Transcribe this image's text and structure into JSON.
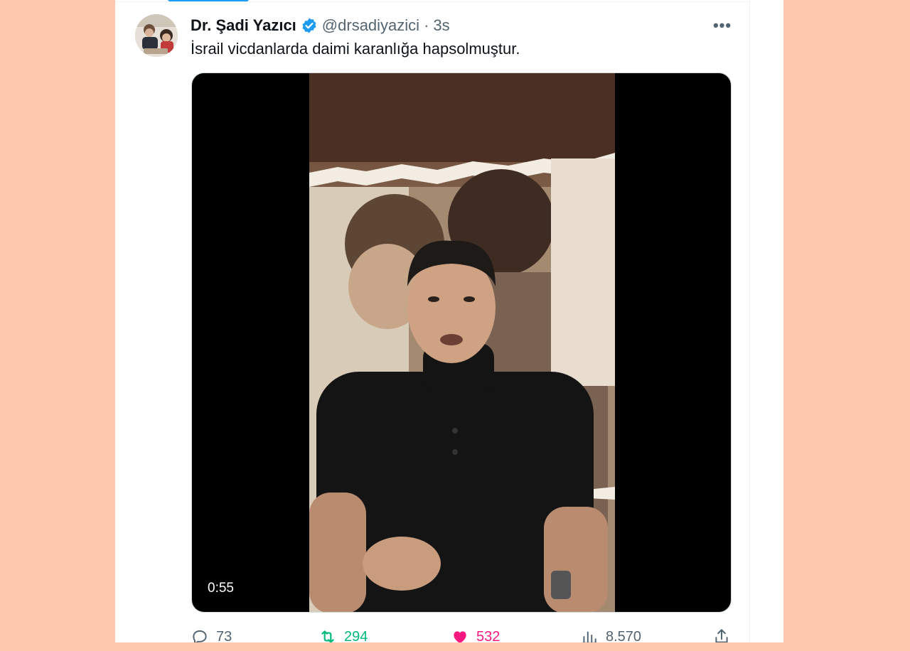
{
  "tweet": {
    "author_name": "Dr. Şadi Yazıcı",
    "handle": "@drsadiyazici",
    "separator": "·",
    "time": "3s",
    "verified_icon": "verified-badge-icon",
    "more_label": "•••",
    "text": "İsrail vicdanlarda daimi karanlığa hapsolmuştur."
  },
  "media": {
    "duration": "0:55"
  },
  "actions": {
    "replies": "73",
    "retweets": "294",
    "likes": "532",
    "views": "8.570"
  },
  "colors": {
    "page_background": "#FFC9B0",
    "card_background": "#FFFFFF",
    "brand_blue": "#1D9BF0",
    "retweet_green": "#00BA7C",
    "like_pink": "#F91880",
    "muted_text": "#536471",
    "primary_text": "#0F1419"
  }
}
